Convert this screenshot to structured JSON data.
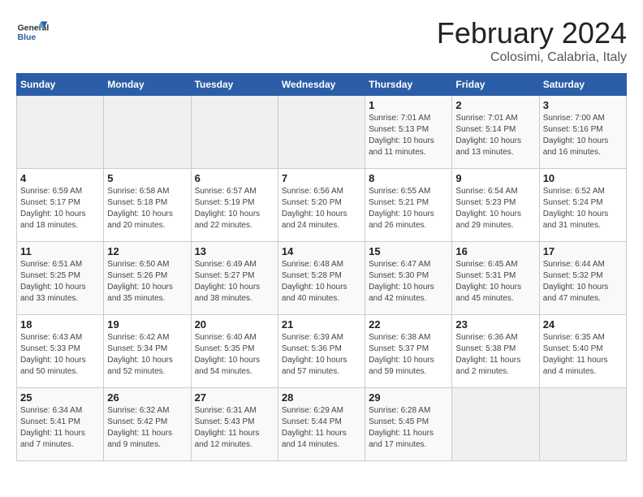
{
  "header": {
    "logo_general": "General",
    "logo_blue": "Blue",
    "title": "February 2024",
    "subtitle": "Colosimi, Calabria, Italy"
  },
  "weekdays": [
    "Sunday",
    "Monday",
    "Tuesday",
    "Wednesday",
    "Thursday",
    "Friday",
    "Saturday"
  ],
  "weeks": [
    [
      {
        "day": "",
        "info": ""
      },
      {
        "day": "",
        "info": ""
      },
      {
        "day": "",
        "info": ""
      },
      {
        "day": "",
        "info": ""
      },
      {
        "day": "1",
        "info": "Sunrise: 7:01 AM\nSunset: 5:13 PM\nDaylight: 10 hours\nand 11 minutes."
      },
      {
        "day": "2",
        "info": "Sunrise: 7:01 AM\nSunset: 5:14 PM\nDaylight: 10 hours\nand 13 minutes."
      },
      {
        "day": "3",
        "info": "Sunrise: 7:00 AM\nSunset: 5:16 PM\nDaylight: 10 hours\nand 16 minutes."
      }
    ],
    [
      {
        "day": "4",
        "info": "Sunrise: 6:59 AM\nSunset: 5:17 PM\nDaylight: 10 hours\nand 18 minutes."
      },
      {
        "day": "5",
        "info": "Sunrise: 6:58 AM\nSunset: 5:18 PM\nDaylight: 10 hours\nand 20 minutes."
      },
      {
        "day": "6",
        "info": "Sunrise: 6:57 AM\nSunset: 5:19 PM\nDaylight: 10 hours\nand 22 minutes."
      },
      {
        "day": "7",
        "info": "Sunrise: 6:56 AM\nSunset: 5:20 PM\nDaylight: 10 hours\nand 24 minutes."
      },
      {
        "day": "8",
        "info": "Sunrise: 6:55 AM\nSunset: 5:21 PM\nDaylight: 10 hours\nand 26 minutes."
      },
      {
        "day": "9",
        "info": "Sunrise: 6:54 AM\nSunset: 5:23 PM\nDaylight: 10 hours\nand 29 minutes."
      },
      {
        "day": "10",
        "info": "Sunrise: 6:52 AM\nSunset: 5:24 PM\nDaylight: 10 hours\nand 31 minutes."
      }
    ],
    [
      {
        "day": "11",
        "info": "Sunrise: 6:51 AM\nSunset: 5:25 PM\nDaylight: 10 hours\nand 33 minutes."
      },
      {
        "day": "12",
        "info": "Sunrise: 6:50 AM\nSunset: 5:26 PM\nDaylight: 10 hours\nand 35 minutes."
      },
      {
        "day": "13",
        "info": "Sunrise: 6:49 AM\nSunset: 5:27 PM\nDaylight: 10 hours\nand 38 minutes."
      },
      {
        "day": "14",
        "info": "Sunrise: 6:48 AM\nSunset: 5:28 PM\nDaylight: 10 hours\nand 40 minutes."
      },
      {
        "day": "15",
        "info": "Sunrise: 6:47 AM\nSunset: 5:30 PM\nDaylight: 10 hours\nand 42 minutes."
      },
      {
        "day": "16",
        "info": "Sunrise: 6:45 AM\nSunset: 5:31 PM\nDaylight: 10 hours\nand 45 minutes."
      },
      {
        "day": "17",
        "info": "Sunrise: 6:44 AM\nSunset: 5:32 PM\nDaylight: 10 hours\nand 47 minutes."
      }
    ],
    [
      {
        "day": "18",
        "info": "Sunrise: 6:43 AM\nSunset: 5:33 PM\nDaylight: 10 hours\nand 50 minutes."
      },
      {
        "day": "19",
        "info": "Sunrise: 6:42 AM\nSunset: 5:34 PM\nDaylight: 10 hours\nand 52 minutes."
      },
      {
        "day": "20",
        "info": "Sunrise: 6:40 AM\nSunset: 5:35 PM\nDaylight: 10 hours\nand 54 minutes."
      },
      {
        "day": "21",
        "info": "Sunrise: 6:39 AM\nSunset: 5:36 PM\nDaylight: 10 hours\nand 57 minutes."
      },
      {
        "day": "22",
        "info": "Sunrise: 6:38 AM\nSunset: 5:37 PM\nDaylight: 10 hours\nand 59 minutes."
      },
      {
        "day": "23",
        "info": "Sunrise: 6:36 AM\nSunset: 5:38 PM\nDaylight: 11 hours\nand 2 minutes."
      },
      {
        "day": "24",
        "info": "Sunrise: 6:35 AM\nSunset: 5:40 PM\nDaylight: 11 hours\nand 4 minutes."
      }
    ],
    [
      {
        "day": "25",
        "info": "Sunrise: 6:34 AM\nSunset: 5:41 PM\nDaylight: 11 hours\nand 7 minutes."
      },
      {
        "day": "26",
        "info": "Sunrise: 6:32 AM\nSunset: 5:42 PM\nDaylight: 11 hours\nand 9 minutes."
      },
      {
        "day": "27",
        "info": "Sunrise: 6:31 AM\nSunset: 5:43 PM\nDaylight: 11 hours\nand 12 minutes."
      },
      {
        "day": "28",
        "info": "Sunrise: 6:29 AM\nSunset: 5:44 PM\nDaylight: 11 hours\nand 14 minutes."
      },
      {
        "day": "29",
        "info": "Sunrise: 6:28 AM\nSunset: 5:45 PM\nDaylight: 11 hours\nand 17 minutes."
      },
      {
        "day": "",
        "info": ""
      },
      {
        "day": "",
        "info": ""
      }
    ]
  ]
}
